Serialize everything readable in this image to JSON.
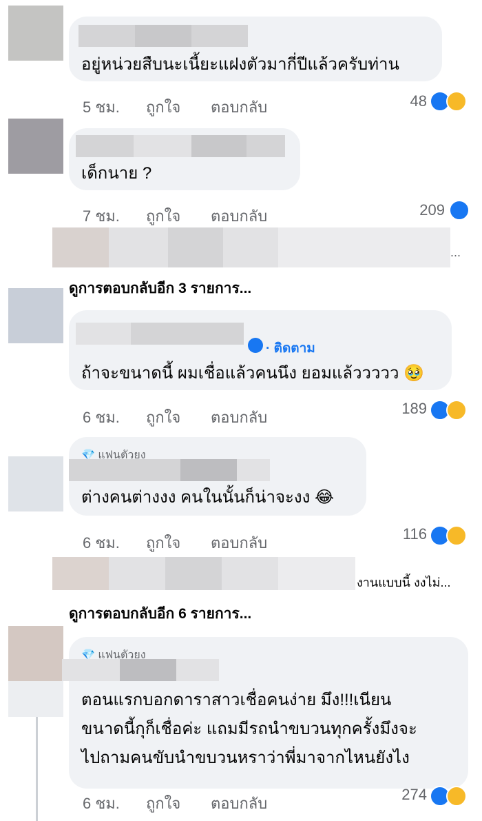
{
  "comments": [
    {
      "text": "อยู่หน่วยสืบนะเนี้ยะแฝงตัวมากี่ปีแล้วครับท่าน",
      "time": "5 ชม.",
      "like": "ถูกใจ",
      "reply": "ตอบกลับ",
      "count": "48"
    },
    {
      "text": "เด็กนาย ?",
      "time": "7 ชม.",
      "like": "ถูกใจ",
      "reply": "ตอบกลับ",
      "count": "209"
    },
    {
      "text": "ถ้าจะขนาดนี้ ผมเชื่อแล้วคนนึง ยอมแล้ววววว 🥹",
      "time": "6 ชม.",
      "like": "ถูกใจ",
      "reply": "ตอบกลับ",
      "count": "189",
      "follow": "· ติดตาม"
    },
    {
      "text": "ต่างคนต่างงง คนในนั้นก็น่าจะงง 😂",
      "time": "6 ชม.",
      "like": "ถูกใจ",
      "reply": "ตอบกลับ",
      "count": "116",
      "badge": "💎 แฟนตัวยง"
    },
    {
      "lines": [
        "ตอนแรกบอกดาราสาวเชื่อคนง่าย มึง!!!เนียน",
        "ขนาดนี้กุก็เชื่อค่ะ แถมมีรถนำขบวนทุกครั้งมึงจะ",
        "ไปถามคนขับนำขบวนหราว่าพี่มาจากไหนยังไง"
      ],
      "time": "6 ชม.",
      "like": "ถูกใจ",
      "reply": "ตอบกลับ",
      "count": "274",
      "badge": "💎 แฟนตัวยง"
    }
  ],
  "truncated_1": "...",
  "truncated_2": "งานแบบนี้ งงไม่...",
  "more_replies_1": "ดูการตอบกลับอีก 3 รายการ...",
  "more_replies_2": "ดูการตอบกลับอีก 6 รายการ...",
  "colors": {
    "like": "#1877f2",
    "haha": "#f7b928",
    "bubble": "#f0f2f5",
    "meta": "#65676b"
  }
}
